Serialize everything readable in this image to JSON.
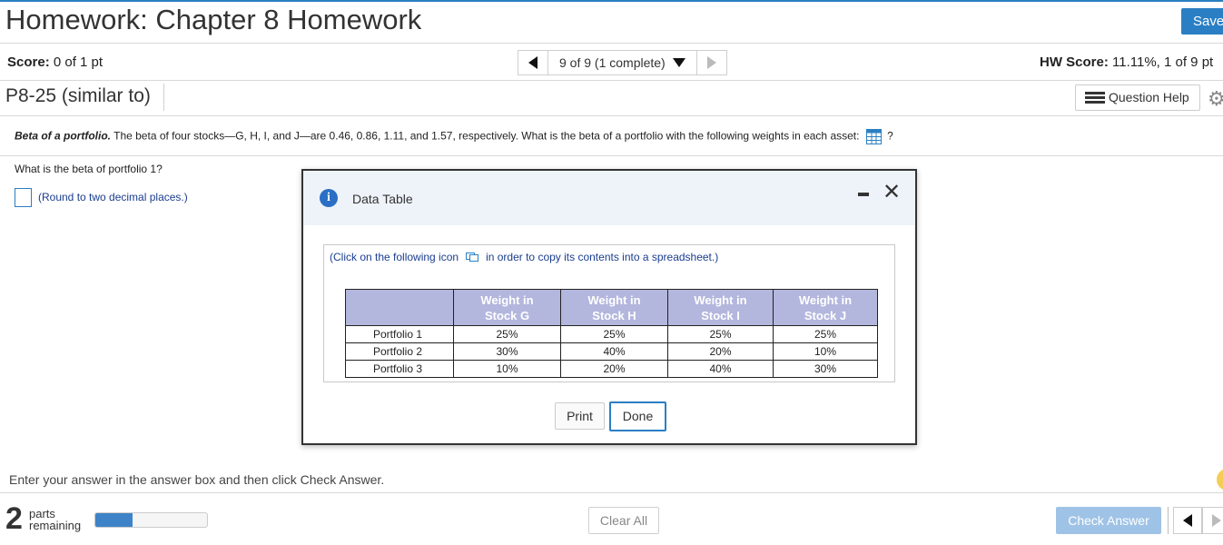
{
  "header": {
    "title": "Homework: Chapter 8 Homework",
    "save_label": "Save"
  },
  "scorebar": {
    "score_label": "Score:",
    "score_value": "0 of 1 pt",
    "nav_text": "9 of 9 (1 complete)",
    "hw_score_label": "HW Score:",
    "hw_score_value": "11.11%, 1 of 9 pt"
  },
  "question_header": {
    "id": "P8-25 (similar to)",
    "help_label": "Question Help"
  },
  "question": {
    "title": "Beta of a portfolio.",
    "text": "The beta of four stocks—G, H, I, and J—are 0.46, 0.86, 1.11, and 1.57, respectively.  What is the beta of a portfolio with the following weights in each asset:",
    "after_icon": "?",
    "prompt": "What is the beta of portfolio 1?",
    "answer_value": "",
    "round_note": "(Round to two decimal places.)"
  },
  "modal": {
    "title": "Data Table",
    "copy_note_before": "(Click on the following icon",
    "copy_note_after": "in order to copy its contents into a spreadsheet.)",
    "table": {
      "headers": [
        "",
        "Weight in Stock G",
        "Weight in Stock H",
        "Weight in Stock I",
        "Weight in Stock J"
      ],
      "header_lines": [
        [
          "Weight in",
          "Stock G"
        ],
        [
          "Weight in",
          "Stock H"
        ],
        [
          "Weight in",
          "Stock I"
        ],
        [
          "Weight in",
          "Stock J"
        ]
      ],
      "rows": [
        [
          "Portfolio 1",
          "25%",
          "25%",
          "25%",
          "25%"
        ],
        [
          "Portfolio 2",
          "30%",
          "40%",
          "20%",
          "10%"
        ],
        [
          "Portfolio 3",
          "10%",
          "20%",
          "40%",
          "30%"
        ]
      ]
    },
    "print_label": "Print",
    "done_label": "Done"
  },
  "footer": {
    "instruction": "Enter your answer in the answer box and then click Check Answer.",
    "parts_count": "2",
    "parts_word": "parts",
    "remaining_word": "remaining",
    "progress_fraction": 0.33,
    "clear_label": "Clear All",
    "check_label": "Check Answer"
  },
  "colors": {
    "accent": "#2a7fc4",
    "table_header": "#b3b6dd",
    "link_text": "#1a3d8f",
    "check_disabled": "#9fc3e6"
  },
  "icons": [
    "minimize-icon",
    "close-icon",
    "info-icon",
    "grid-icon",
    "copy-icon",
    "gear-icon",
    "list-icon",
    "caret-left-icon",
    "caret-right-icon",
    "caret-down-icon"
  ]
}
